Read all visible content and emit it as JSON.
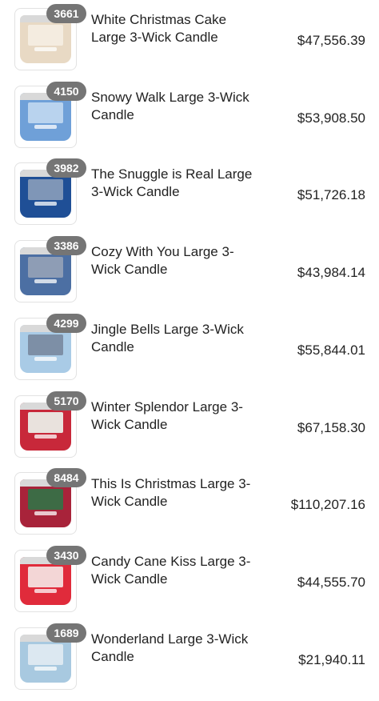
{
  "products": [
    {
      "count": "3661",
      "name": "White Christmas Cake Large 3-Wick Candle",
      "price": "$47,556.39",
      "jar_color": "#e8d9c4",
      "art_color": "#f4ece0"
    },
    {
      "count": "4150",
      "name": "Snowy Walk Large 3-Wick Candle",
      "price": "$53,908.50",
      "jar_color": "#6fa0d8",
      "art_color": "#b9d3ee"
    },
    {
      "count": "3982",
      "name": "The Snuggle is Real Large 3-Wick Candle",
      "price": "$51,726.18",
      "jar_color": "#1f4f96",
      "art_color": "#7f96b7"
    },
    {
      "count": "3386",
      "name": "Cozy With You Large 3-Wick Candle",
      "price": "$43,984.14",
      "jar_color": "#4c6fa3",
      "art_color": "#8e9db5"
    },
    {
      "count": "4299",
      "name": "Jingle Bells Large 3-Wick Candle",
      "price": "$55,844.01",
      "jar_color": "#a9cbe6",
      "art_color": "#7d8fa6"
    },
    {
      "count": "5170",
      "name": "Winter Splendor Large 3-Wick Candle",
      "price": "$67,158.30",
      "jar_color": "#c8283a",
      "art_color": "#e9e2dd"
    },
    {
      "count": "8484",
      "name": "This Is Christmas Large 3-Wick Candle",
      "price": "$110,207.16",
      "jar_color": "#a8233a",
      "art_color": "#3d6b45"
    },
    {
      "count": "3430",
      "name": "Candy Cane Kiss Large 3-Wick Candle",
      "price": "$44,555.70",
      "jar_color": "#e02b3b",
      "art_color": "#f3d6d6"
    },
    {
      "count": "1689",
      "name": "Wonderland Large 3-Wick Candle",
      "price": "$21,940.11",
      "jar_color": "#a8c9e0",
      "art_color": "#dce8f1"
    }
  ]
}
